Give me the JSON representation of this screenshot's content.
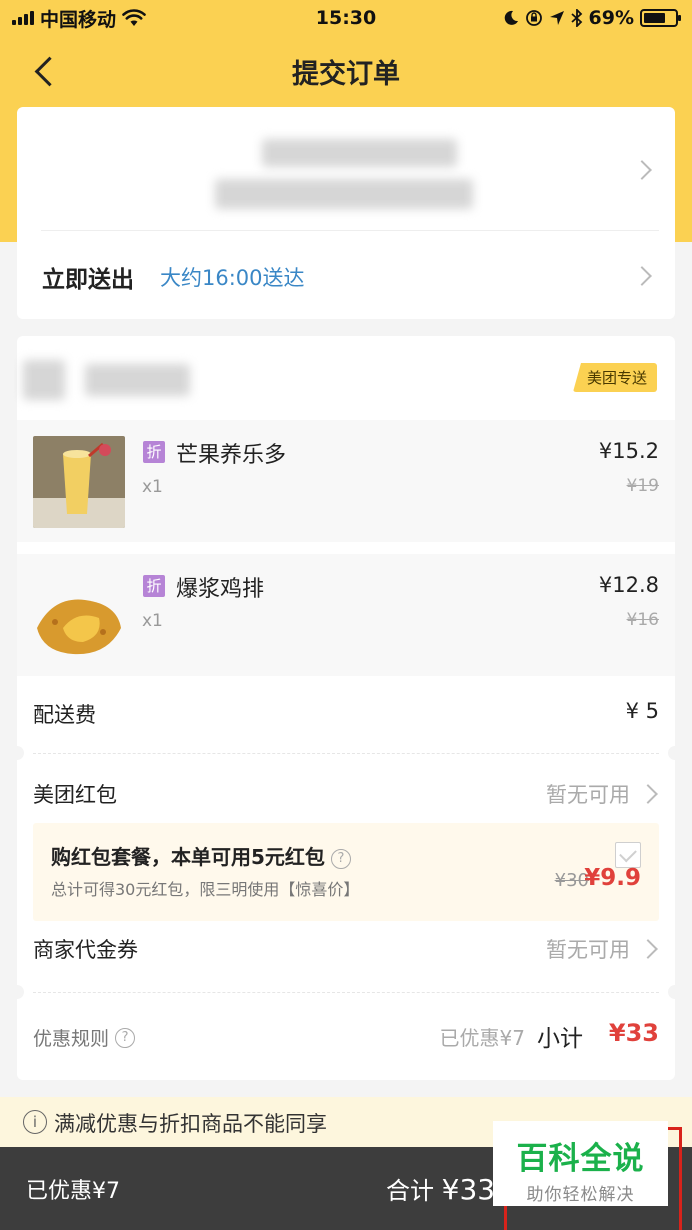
{
  "status_bar": {
    "carrier": "中国移动",
    "time": "15:30",
    "battery_text": "69%",
    "battery_level": 0.69
  },
  "nav": {
    "title": "提交订单"
  },
  "delivery": {
    "mode": "立即送出",
    "eta": "大约16:00送达"
  },
  "store": {
    "badge": "美团专送"
  },
  "items": [
    {
      "badge": "折",
      "name": "芒果养乐多",
      "qty": "x1",
      "price": "¥15.2",
      "orig_price": "¥19"
    },
    {
      "badge": "折",
      "name": "爆浆鸡排",
      "qty": "x1",
      "price": "¥12.8",
      "orig_price": "¥16"
    }
  ],
  "fees": {
    "delivery_label": "配送费",
    "delivery_value": "¥ 5"
  },
  "red_packet": {
    "label": "美团红包",
    "value": "暂无可用"
  },
  "promo": {
    "title": "购红包套餐，本单可用5元红包",
    "subtitle": "总计可得30元红包，限三明使用【惊喜价】",
    "orig_price": "¥30",
    "price": "¥9.9"
  },
  "voucher": {
    "label": "商家代金券",
    "value": "暂无可用"
  },
  "summary": {
    "rules_label": "优惠规则",
    "already_off": "已优惠¥7",
    "subtotal_label": "小计",
    "subtotal_value": "¥33"
  },
  "notice": {
    "text": "满减优惠与折扣商品不能同享"
  },
  "bottom": {
    "discount": "已优惠¥7",
    "total_label": "合计",
    "total_value": "¥33"
  },
  "watermark": {
    "title": "百科全说",
    "subtitle": "助你轻松解决"
  }
}
